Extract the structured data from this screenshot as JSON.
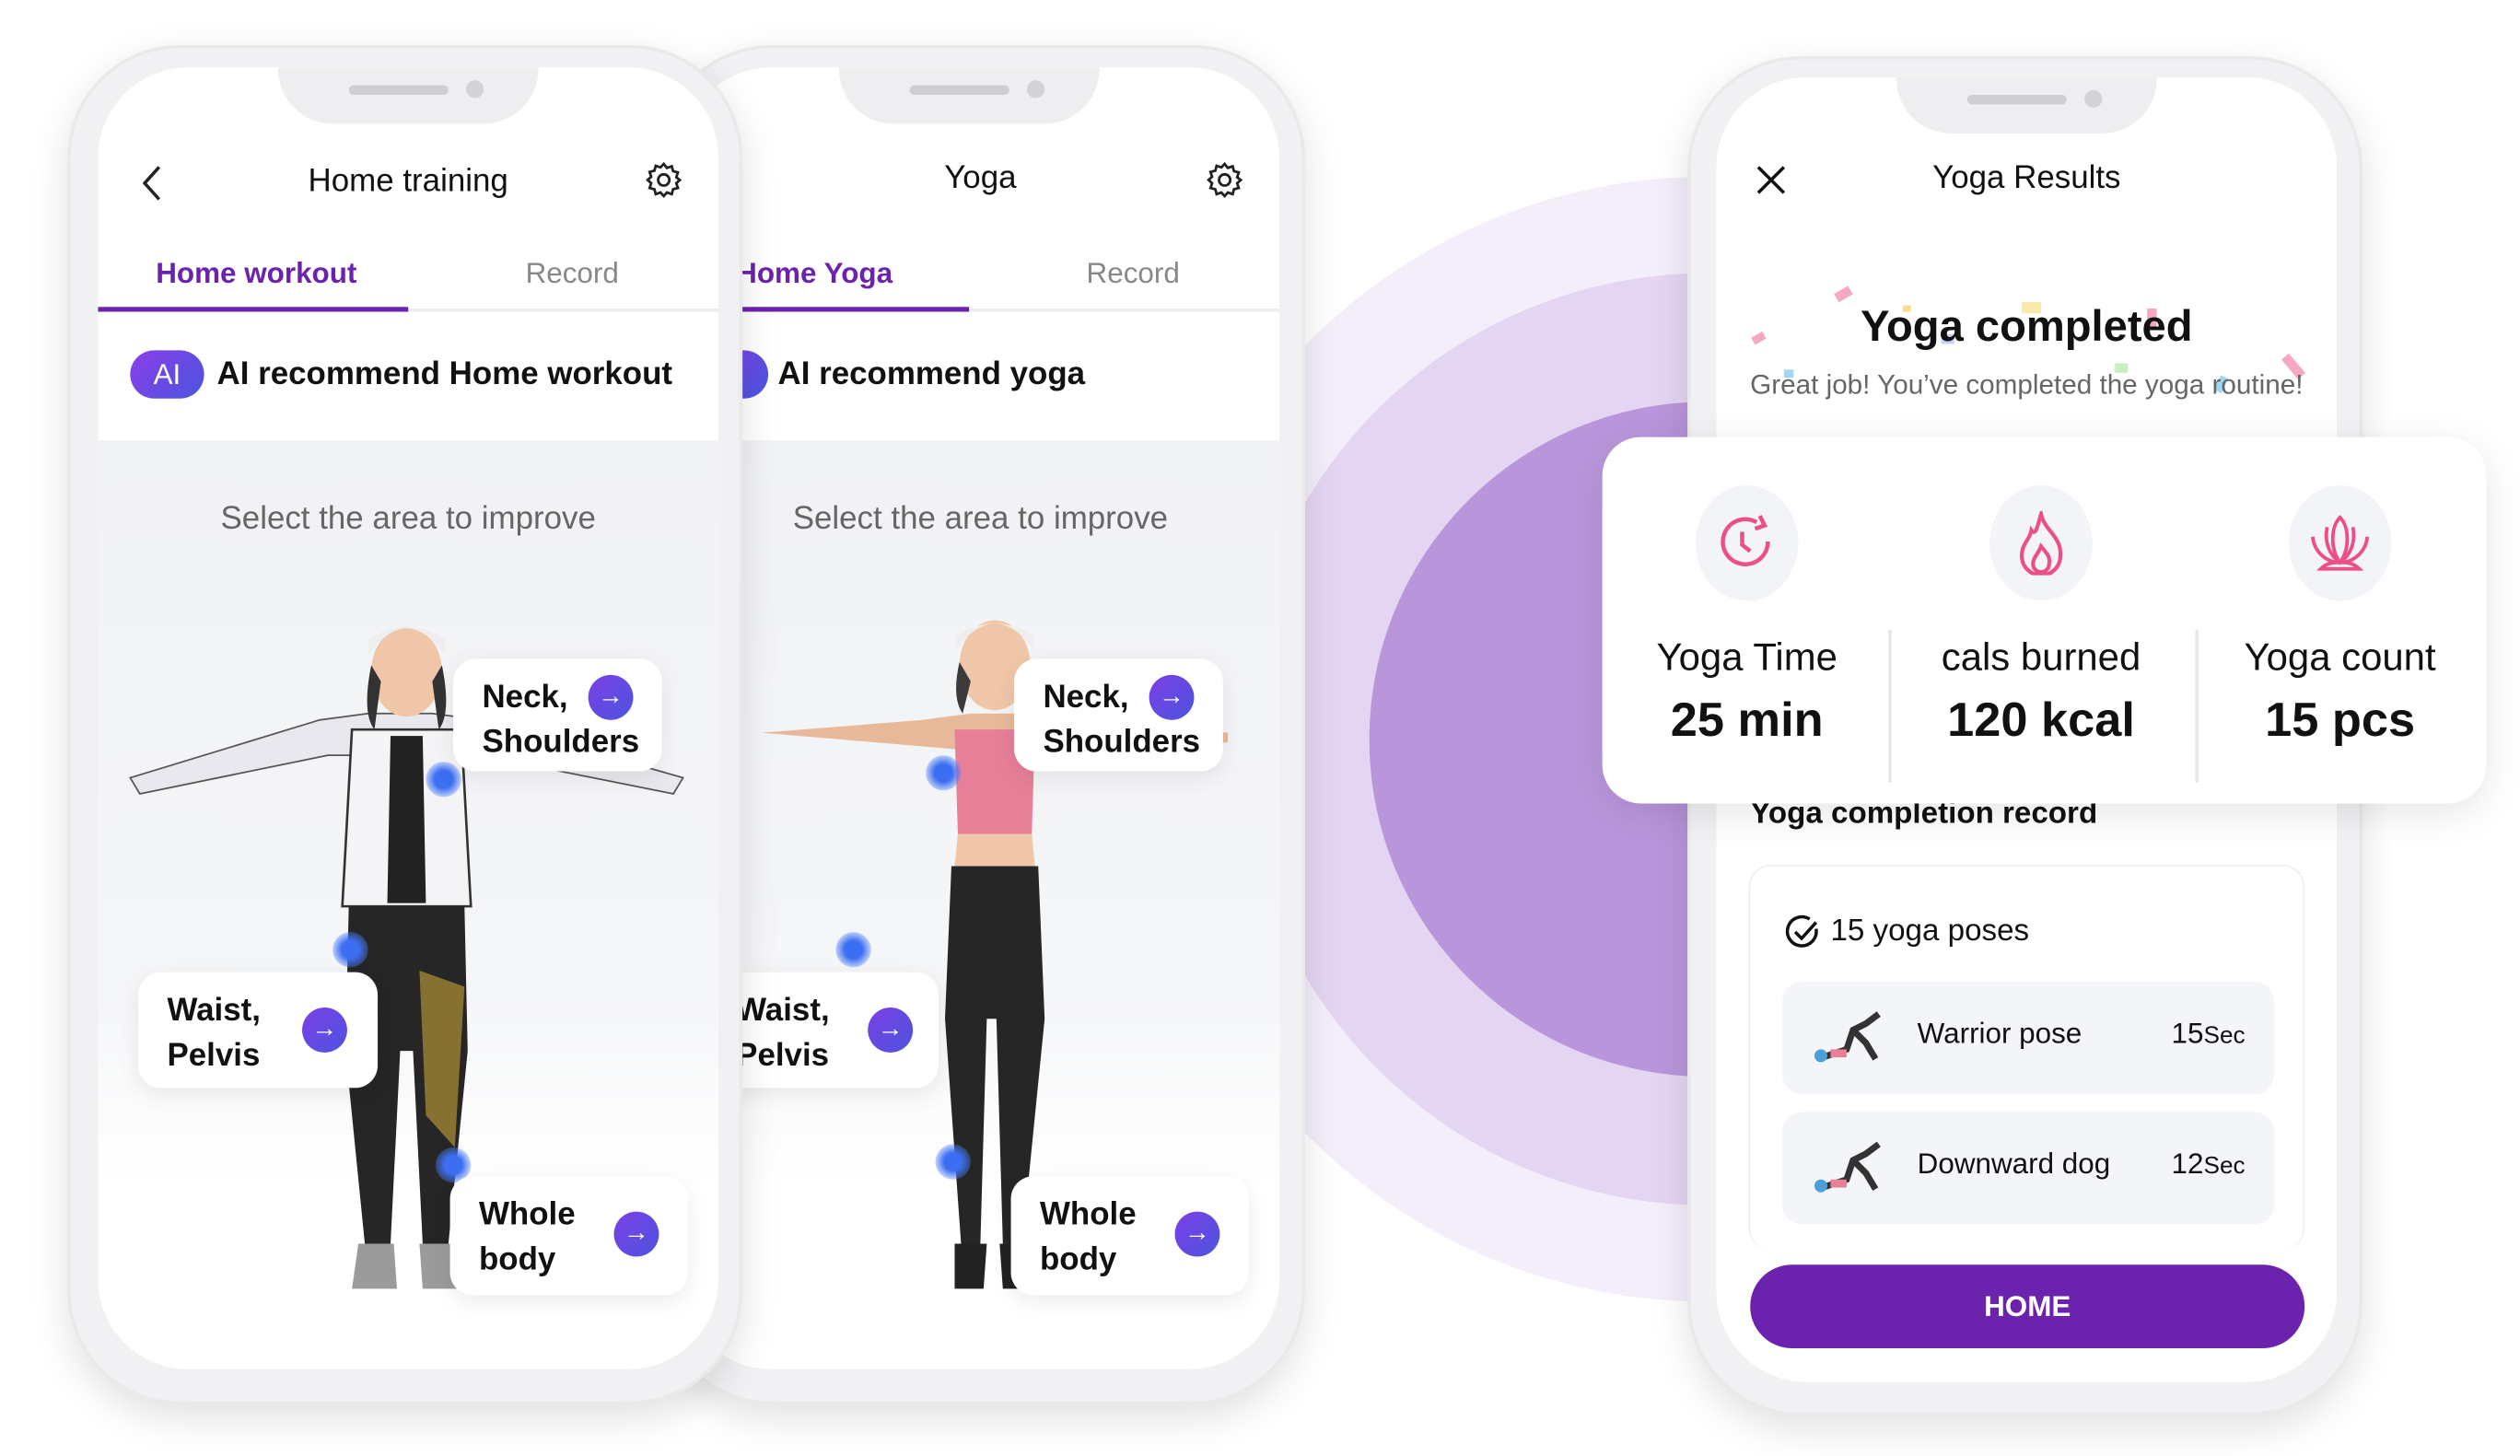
{
  "colors": {
    "accent": "#6b22ad",
    "button": "#6b22ad",
    "icon_pink": "#ec4f87",
    "badge_gradient": [
      "#8b3ee8",
      "#4a55e0"
    ]
  },
  "phone1": {
    "title": "Home training",
    "back_icon": "chevron-left-icon",
    "settings_icon": "gear-icon",
    "tabs": [
      {
        "label": "Home workout",
        "active": true
      },
      {
        "label": "Record",
        "active": false
      }
    ],
    "ai_badge": "AI",
    "ai_text": "AI recommend Home workout",
    "prompt": "Select the area to improve",
    "hotspots": [
      {
        "label_1": "Neck,",
        "label_2": "Shoulders"
      },
      {
        "label_1": "Waist,",
        "label_2": "Pelvis"
      },
      {
        "label_1": "Whole",
        "label_2": "body"
      }
    ]
  },
  "phone2": {
    "title": "Yoga",
    "settings_icon": "gear-icon",
    "tabs": [
      {
        "label": "Home Yoga",
        "active": true
      },
      {
        "label": "Record",
        "active": false
      }
    ],
    "ai_text": "AI recommend yoga",
    "prompt": "Select the area to improve",
    "hotspots": [
      {
        "label_1": "Neck,",
        "label_2": "Shoulders"
      },
      {
        "label_1": "Waist,",
        "label_2": "Pelvis"
      },
      {
        "label_1": "Whole",
        "label_2": "body"
      }
    ]
  },
  "phone3": {
    "title": "Yoga Results",
    "close_icon": "close-icon",
    "headline": "Yoga completed",
    "subtitle": "Great job! You’ve completed the yoga routine!",
    "stats": [
      {
        "icon": "timer-icon",
        "label": "Yoga Time",
        "value": "25 min"
      },
      {
        "icon": "flame-icon",
        "label": "cals burned",
        "value": "120 kcal"
      },
      {
        "icon": "lotus-icon",
        "label": "Yoga count",
        "value": "15 pcs"
      }
    ],
    "record_title": "Yoga completion record",
    "poses_count": "15 yoga poses",
    "poses": [
      {
        "name": "Warrior pose",
        "value": "15",
        "unit": "Sec"
      },
      {
        "name": "Downward dog",
        "value": "12",
        "unit": "Sec"
      }
    ],
    "home_button": "HOME"
  }
}
